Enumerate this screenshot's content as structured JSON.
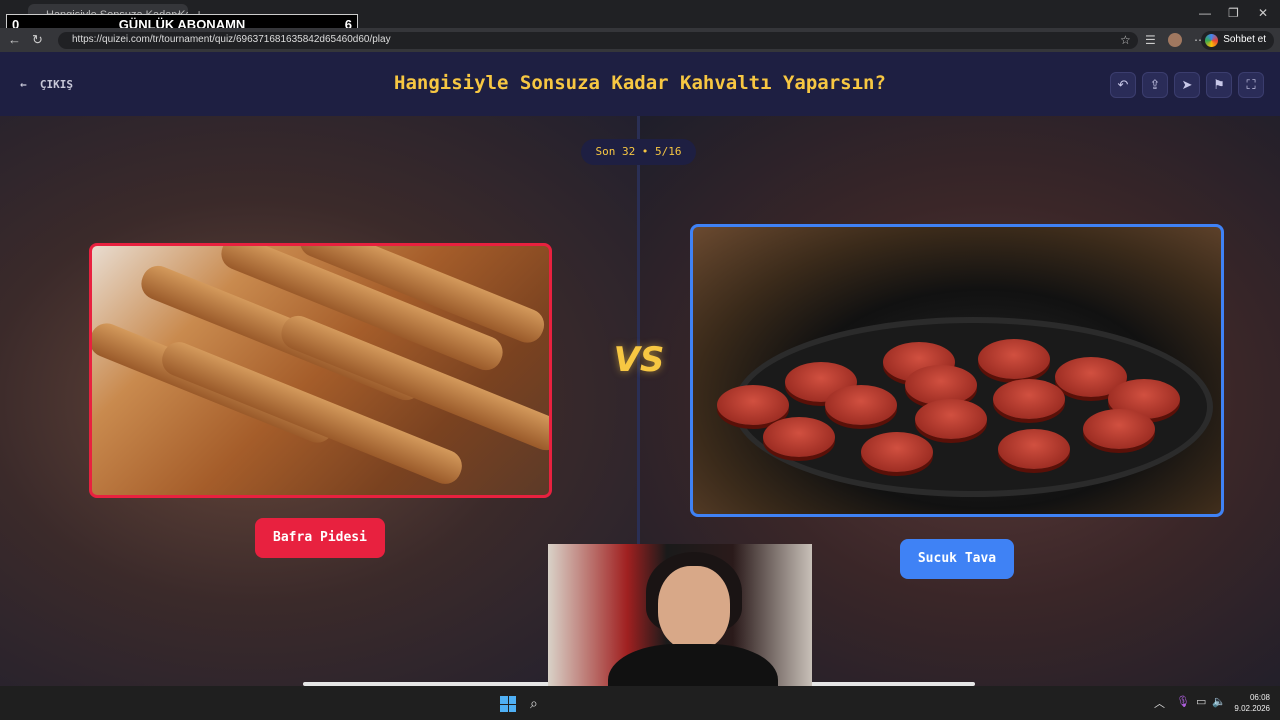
{
  "browser": {
    "tab_title": "Hangisiyle Sonsuza Kadar Kahvaltı Yaparsın?",
    "tab_close": "✕",
    "new_tab": "+",
    "url": "https://quizei.com/tr/tournament/quiz/696371681635842d65460d60/play",
    "chat_label": "Sohbet et"
  },
  "stream_overlay": {
    "left_count": "0",
    "label": "GÜNLÜK ABONAMN",
    "right_count": "6"
  },
  "header": {
    "exit_label": "ÇIKIŞ",
    "title": "Hangisiyle Sonsuza Kadar Kahvaltı Yaparsın?"
  },
  "round": {
    "label": "Son 32 • 5/16"
  },
  "choices": {
    "left": {
      "label": "Bafra Pidesi",
      "border_color": "#e8213f"
    },
    "right": {
      "label": "Sucuk Tava",
      "border_color": "#3f82f5"
    }
  },
  "vs_label": "VS",
  "taskbar": {
    "time": "06:08",
    "date": "9.02.2026"
  },
  "icons": {
    "back": "arrow-left-icon",
    "undo": "undo-icon",
    "share": "share-icon",
    "send": "send-icon",
    "flag": "flag-icon",
    "fullscreen": "fullscreen-icon"
  }
}
